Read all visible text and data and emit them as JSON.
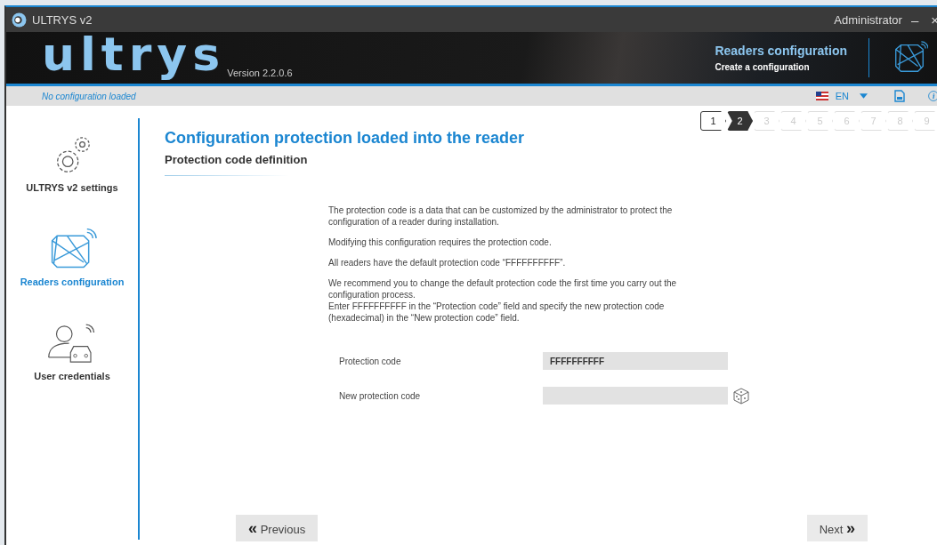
{
  "window": {
    "title": "ULTRYS v2",
    "user": "Administrator",
    "minimize": "–",
    "close": "×"
  },
  "banner": {
    "logo": "ultrys",
    "version": "Version 2.2.0.6",
    "section": "Readers configuration",
    "subsection": "Create a configuration"
  },
  "toolbar": {
    "status": "No configuration loaded",
    "language": "EN"
  },
  "steps": [
    {
      "label": "1",
      "selected": false,
      "disabled": false
    },
    {
      "label": "2",
      "selected": true,
      "disabled": false
    },
    {
      "label": "3",
      "selected": false,
      "disabled": true
    },
    {
      "label": "4",
      "selected": false,
      "disabled": true
    },
    {
      "label": "5",
      "selected": false,
      "disabled": true
    },
    {
      "label": "6",
      "selected": false,
      "disabled": true
    },
    {
      "label": "7",
      "selected": false,
      "disabled": true
    },
    {
      "label": "8",
      "selected": false,
      "disabled": true
    },
    {
      "label": "9",
      "selected": false,
      "disabled": true
    }
  ],
  "sidebar": {
    "items": [
      {
        "label": "ULTRYS v2 settings",
        "kind": "gears",
        "selected": false
      },
      {
        "label": "Readers configuration",
        "kind": "reader",
        "selected": true
      },
      {
        "label": "User credentials",
        "kind": "user",
        "selected": false
      }
    ]
  },
  "page": {
    "title": "Configuration protection loaded into the reader",
    "subtitle": "Protection code definition",
    "paragraphs": [
      "The protection code is a data that can be customized by the administrator to protect the configuration of a reader during installation.",
      "Modifying this configuration requires the protection code.",
      "All readers have the default protection code “FFFFFFFFFF”.",
      "We recommend you to change the default protection code the first time you carry out the configuration process.\nEnter FFFFFFFFFF in the “Protection code” field and specify the new protection code (hexadecimal) in the “New protection code” field."
    ],
    "fields": [
      {
        "label": "Protection code",
        "value": "FFFFFFFFFF",
        "generator": false
      },
      {
        "label": "New protection code",
        "generator": true
      }
    ]
  },
  "buttons": {
    "previous": {
      "icon": "«",
      "label": "Previous"
    },
    "next": {
      "label": "Next",
      "icon": "»"
    }
  }
}
